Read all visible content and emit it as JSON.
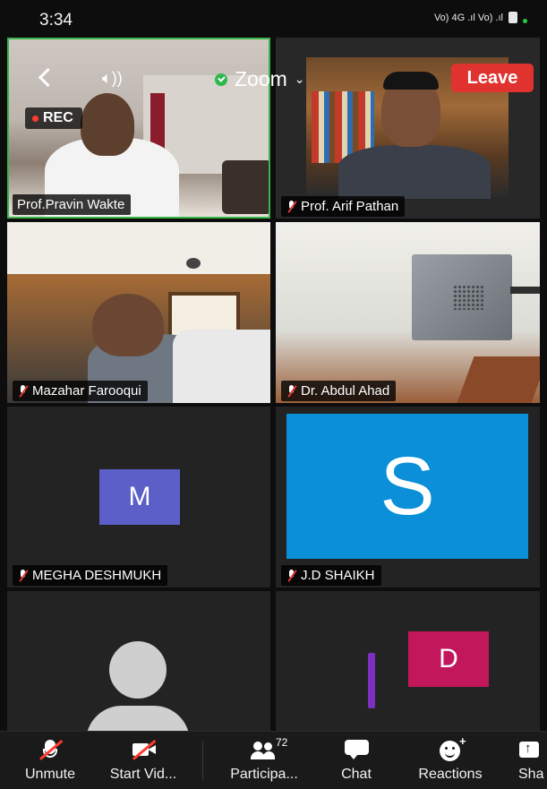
{
  "status_bar": {
    "time": "3:34",
    "network_text": "Vo) 4G .ıl Vo) .ıl"
  },
  "meeting": {
    "title": "Zoom",
    "leave_label": "Leave",
    "rec_label": "REC",
    "accent_color": "#2db84d",
    "leave_color": "#e0332f"
  },
  "participants": [
    {
      "name": "Prof.Pravin Wakte",
      "muted": false,
      "video": true,
      "active_speaker": true
    },
    {
      "name": "Prof. Arif Pathan",
      "muted": true,
      "video": true
    },
    {
      "name": "Mazahar Farooqui",
      "muted": true,
      "video": true
    },
    {
      "name": "Dr. Abdul Ahad",
      "muted": true,
      "video": true
    },
    {
      "name": "MEGHA DESHMUKH",
      "muted": true,
      "video": false,
      "avatar_letter": "M",
      "avatar_color": "#5b5fc7"
    },
    {
      "name": "J.D SHAIKH",
      "muted": true,
      "video": false,
      "avatar_letter": "S",
      "avatar_color": "#0a8fd8"
    },
    {
      "name": "",
      "muted": false,
      "video": false,
      "avatar": "person-silhouette-icon"
    },
    {
      "name": "",
      "muted": false,
      "video": false,
      "avatar_letter": "D",
      "avatar_color": "#c2185b"
    }
  ],
  "toolbar": {
    "unmute_label": "Unmute",
    "start_video_label": "Start Vid...",
    "participants_label": "Participa...",
    "participants_count": "72",
    "chat_label": "Chat",
    "reactions_label": "Reactions",
    "share_label": "Sha"
  }
}
